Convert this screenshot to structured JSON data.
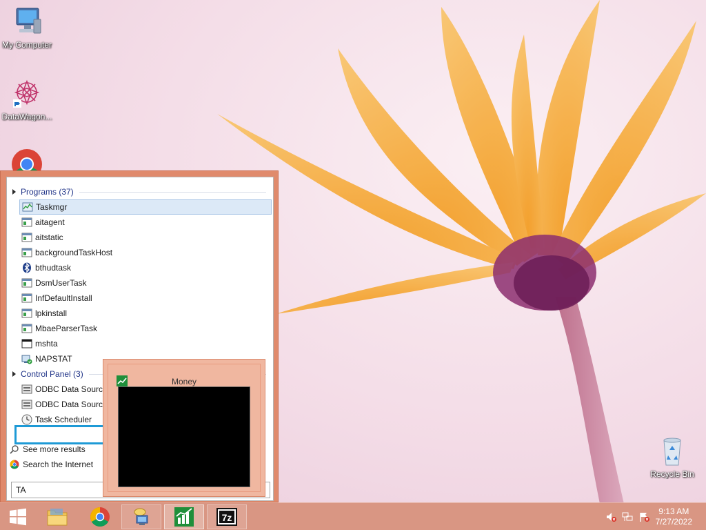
{
  "desktop": {
    "icons": [
      {
        "label": "My Computer"
      },
      {
        "label": "DataWagon..."
      },
      {
        "label": "Recycle Bin"
      }
    ]
  },
  "start_menu": {
    "groups": [
      {
        "title": "Programs (37)",
        "items": [
          {
            "label": "Taskmgr",
            "icon": "taskmgr-icon",
            "selected": true
          },
          {
            "label": "aitagent",
            "icon": "app-window-icon"
          },
          {
            "label": "aitstatic",
            "icon": "app-window-icon"
          },
          {
            "label": "backgroundTaskHost",
            "icon": "app-window-icon"
          },
          {
            "label": "bthudtask",
            "icon": "bluetooth-icon"
          },
          {
            "label": "DsmUserTask",
            "icon": "app-window-icon"
          },
          {
            "label": "InfDefaultInstall",
            "icon": "app-window-icon"
          },
          {
            "label": "lpkinstall",
            "icon": "app-window-icon"
          },
          {
            "label": "MbaeParserTask",
            "icon": "app-window-icon"
          },
          {
            "label": "mshta",
            "icon": "mshta-icon"
          },
          {
            "label": "NAPSTAT",
            "icon": "napstat-icon"
          }
        ]
      },
      {
        "title": "Control Panel (3)",
        "items": [
          {
            "label": "ODBC Data Sources",
            "icon": "odbc-icon"
          },
          {
            "label": "ODBC Data Sources",
            "icon": "odbc-icon"
          },
          {
            "label": "Task Scheduler",
            "icon": "clock-icon"
          }
        ]
      }
    ],
    "see_more": "See more results",
    "search_internet": "Search the Internet",
    "search_value": "TA"
  },
  "preview": {
    "title": "Money"
  },
  "taskbar": {
    "clock_time": "9:13 AM",
    "clock_date": "7/27/2022"
  },
  "colors": {
    "accent": "#e08a6c",
    "taskbar": "#d99683",
    "highlight": "#1e9ad6"
  }
}
